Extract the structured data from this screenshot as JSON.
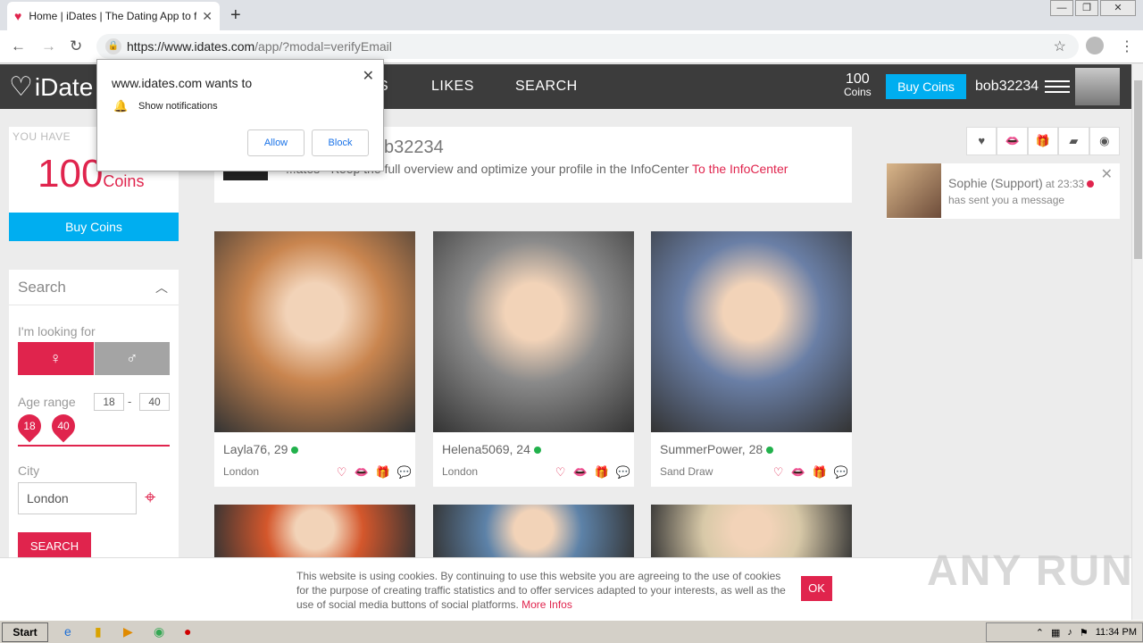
{
  "browser": {
    "tab_title": "Home | iDates | The Dating App to fli",
    "url_host": "https://www.idates.com",
    "url_path": "/app/?modal=verifyEmail"
  },
  "permission_popup": {
    "title": "www.idates.com wants to",
    "subtitle": "Show notifications",
    "allow": "Allow",
    "block": "Block"
  },
  "header": {
    "logo_text": "iDate",
    "nav_partial": "S",
    "nav_likes": "LIKES",
    "nav_search": "SEARCH",
    "coins_count": "100",
    "coins_label": "Coins",
    "buy_coins": "Buy Coins",
    "username": "bob32234"
  },
  "sidebar": {
    "you_have": "YOU HAVE",
    "coins_big": "100",
    "coins_unit": "Coins",
    "buy_coins": "Buy Coins",
    "search_title": "Search",
    "looking_for": "I'm looking for",
    "age_range": "Age range",
    "age_min": "18",
    "age_max": "40",
    "age_dash": "-",
    "city_label": "City",
    "city_value": "London",
    "search_button": "SEARCH"
  },
  "welcome": {
    "hello": "b32234",
    "text": "...ates - Keep the full overview and optimize your profile in the InfoCenter",
    "link": "To the InfoCenter"
  },
  "profiles": [
    {
      "name": "Layla76, 29",
      "city": "London",
      "photo_color": "#c9854f"
    },
    {
      "name": "Helena5069, 24",
      "city": "London",
      "photo_color": "#8a8a8a"
    },
    {
      "name": "SummerPower, 28",
      "city": "Sand Draw",
      "photo_color": "#6a7fa6"
    }
  ],
  "partial_photo_colors": [
    "#d4572c",
    "#5d82a8",
    "#d8c9a8"
  ],
  "notification": {
    "who": "Sophie (Support)",
    "time": "at 23:33",
    "message": "has sent you a message"
  },
  "cookie": {
    "text": "This website is using cookies. By continuing to use this website you are agreeing to the use of cookies for the purpose of creating traffic statistics and to offer services adapted to your interests, as well as the use of social media buttons of social platforms.",
    "link": "More Infos",
    "ok": "OK"
  },
  "watermark": "ANY RUN",
  "taskbar": {
    "start": "Start",
    "time": "11:34 PM"
  },
  "colors": {
    "brand": "#e0244d",
    "accent": "#00aef0",
    "header_bg": "#3c3c3c"
  }
}
